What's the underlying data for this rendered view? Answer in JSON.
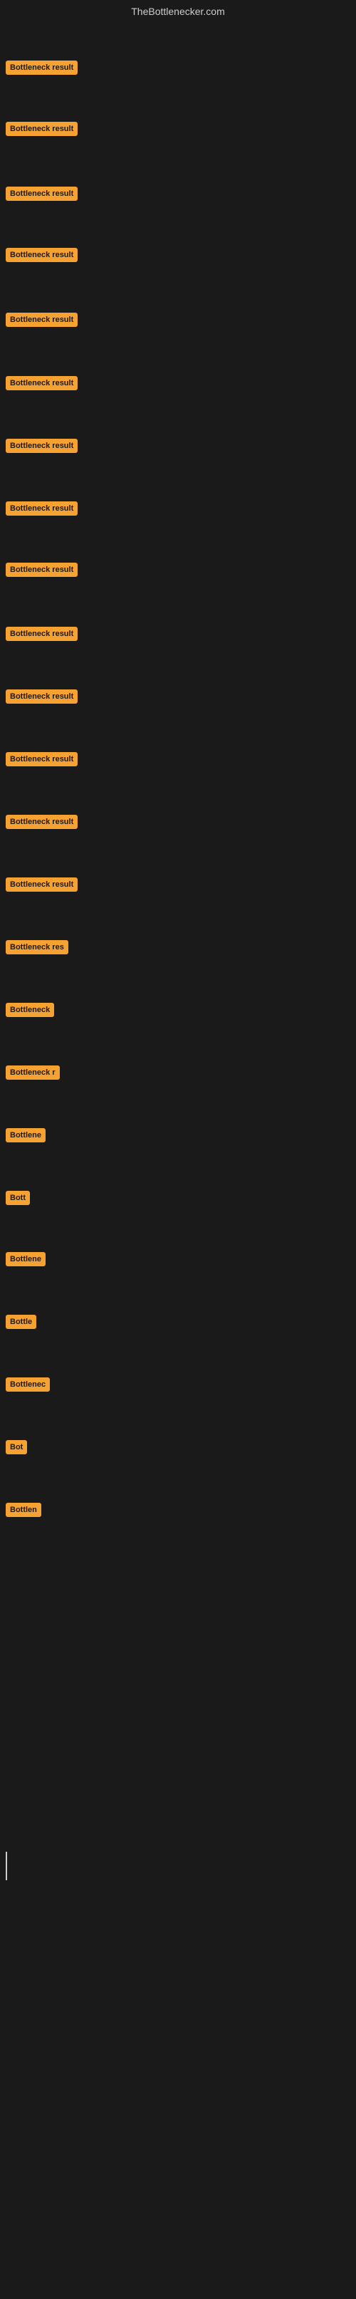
{
  "site": {
    "title": "TheBottlenecker.com"
  },
  "items": [
    {
      "id": 1,
      "label": "Bottleneck result",
      "badgeClass": "badge-full",
      "topOffset": 57
    },
    {
      "id": 2,
      "label": "Bottleneck result",
      "badgeClass": "badge-full",
      "topOffset": 143
    },
    {
      "id": 3,
      "label": "Bottleneck result",
      "badgeClass": "badge-full",
      "topOffset": 234
    },
    {
      "id": 4,
      "label": "Bottleneck result",
      "badgeClass": "badge-full",
      "topOffset": 320
    },
    {
      "id": 5,
      "label": "Bottleneck result",
      "badgeClass": "badge-full",
      "topOffset": 411
    },
    {
      "id": 6,
      "label": "Bottleneck result",
      "badgeClass": "badge-full",
      "topOffset": 500
    },
    {
      "id": 7,
      "label": "Bottleneck result",
      "badgeClass": "badge-full",
      "topOffset": 588
    },
    {
      "id": 8,
      "label": "Bottleneck result",
      "badgeClass": "badge-full",
      "topOffset": 676
    },
    {
      "id": 9,
      "label": "Bottleneck result",
      "badgeClass": "badge-full",
      "topOffset": 762
    },
    {
      "id": 10,
      "label": "Bottleneck result",
      "badgeClass": "badge-full",
      "topOffset": 852
    },
    {
      "id": 11,
      "label": "Bottleneck result",
      "badgeClass": "badge-full",
      "topOffset": 940
    },
    {
      "id": 12,
      "label": "Bottleneck result",
      "badgeClass": "badge-full",
      "topOffset": 1028
    },
    {
      "id": 13,
      "label": "Bottleneck result",
      "badgeClass": "badge-full",
      "topOffset": 1116
    },
    {
      "id": 14,
      "label": "Bottleneck result",
      "badgeClass": "badge-full",
      "topOffset": 1204
    },
    {
      "id": 15,
      "label": "Bottleneck res",
      "badgeClass": "badge-w1",
      "topOffset": 1292
    },
    {
      "id": 16,
      "label": "Bottleneck",
      "badgeClass": "badge-w2",
      "topOffset": 1380
    },
    {
      "id": 17,
      "label": "Bottleneck r",
      "badgeClass": "badge-w1",
      "topOffset": 1468
    },
    {
      "id": 18,
      "label": "Bottlene",
      "badgeClass": "badge-w3",
      "topOffset": 1556
    },
    {
      "id": 19,
      "label": "Bott",
      "badgeClass": "badge-w4",
      "topOffset": 1644
    },
    {
      "id": 20,
      "label": "Bottlene",
      "badgeClass": "badge-w3",
      "topOffset": 1730
    },
    {
      "id": 21,
      "label": "Bottle",
      "badgeClass": "badge-w5",
      "topOffset": 1818
    },
    {
      "id": 22,
      "label": "Bottlenec",
      "badgeClass": "badge-w2",
      "topOffset": 1906
    },
    {
      "id": 23,
      "label": "Bot",
      "badgeClass": "badge-w6",
      "topOffset": 1994
    },
    {
      "id": 24,
      "label": "Bottlen",
      "badgeClass": "badge-w3",
      "topOffset": 2082
    }
  ],
  "cursor": {
    "topOffset": 2600
  }
}
